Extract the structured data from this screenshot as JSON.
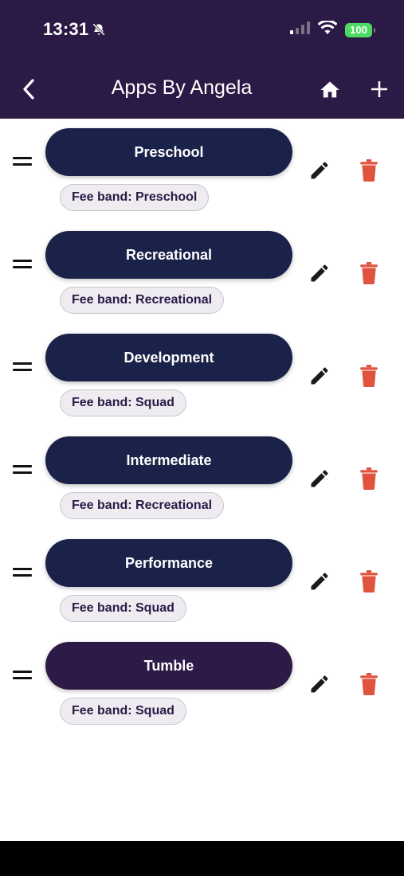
{
  "status_bar": {
    "time": "13:31",
    "battery": "100",
    "icons": [
      "bell-slash-icon",
      "signal-icon",
      "wifi-icon",
      "battery-icon"
    ]
  },
  "nav": {
    "title": "Apps By Angela",
    "back_icon": "chevron-left-icon",
    "home_icon": "home-icon",
    "add_icon": "plus-icon"
  },
  "colors": {
    "header_bg": "#2b1a45",
    "pill_navy": "#1b2249",
    "pill_purple": "#2d1a46",
    "delete_red": "#e0533f",
    "chip_bg": "#eeebf1"
  },
  "groups": [
    {
      "name": "Preschool",
      "fee_band": "Fee band: Preschool",
      "style": "navy"
    },
    {
      "name": "Recreational",
      "fee_band": "Fee band: Recreational",
      "style": "navy"
    },
    {
      "name": "Development",
      "fee_band": "Fee band: Squad",
      "style": "navy"
    },
    {
      "name": "Intermediate",
      "fee_band": "Fee band: Recreational",
      "style": "navy"
    },
    {
      "name": "Performance",
      "fee_band": "Fee band: Squad",
      "style": "navy"
    },
    {
      "name": "Tumble",
      "fee_band": "Fee band: Squad",
      "style": "purple"
    }
  ]
}
